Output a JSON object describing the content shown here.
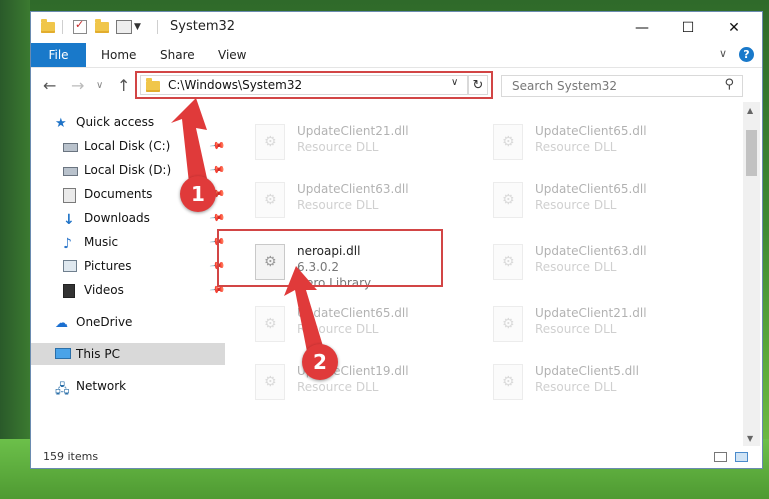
{
  "window": {
    "title": "System32",
    "controls": {
      "minimize": "—",
      "maximize": "☐",
      "close": "✕"
    }
  },
  "ribbon": {
    "tabs": [
      "File",
      "Home",
      "Share",
      "View"
    ],
    "help": "?"
  },
  "address": {
    "path": "C:\\Windows\\System32",
    "refresh_icon": "↻"
  },
  "search": {
    "placeholder": "Search System32"
  },
  "sidebar": {
    "items": [
      {
        "label": "Quick access",
        "icon": "star-icon"
      },
      {
        "label": "Local Disk (C:)",
        "icon": "drive-icon",
        "pinned": true
      },
      {
        "label": "Local Disk (D:)",
        "icon": "drive-icon",
        "pinned": true
      },
      {
        "label": "Documents",
        "icon": "documents-icon",
        "pinned": true
      },
      {
        "label": "Downloads",
        "icon": "download-icon",
        "pinned": true
      },
      {
        "label": "Music",
        "icon": "music-icon",
        "pinned": true
      },
      {
        "label": "Pictures",
        "icon": "pictures-icon",
        "pinned": true
      },
      {
        "label": "Videos",
        "icon": "videos-icon",
        "pinned": true
      },
      {
        "label": "OneDrive",
        "icon": "cloud-icon"
      },
      {
        "label": "This PC",
        "icon": "computer-icon",
        "selected": true
      },
      {
        "label": "Network",
        "icon": "network-icon"
      }
    ]
  },
  "files": {
    "left": [
      {
        "name": "UpdateClient21.dll",
        "type": "Resource DLL"
      },
      {
        "name": "UpdateClient63.dll",
        "type": "Resource DLL"
      },
      {
        "name": "neroapi.dll",
        "version": "6.3.0.2",
        "type": "Nero Library"
      },
      {
        "name": "UpdateClient65.dll",
        "type": "Resource DLL"
      },
      {
        "name": "UpdateClient19.dll",
        "type": "Resource DLL"
      }
    ],
    "right": [
      {
        "name": "UpdateClient65.dll",
        "type": "Resource DLL"
      },
      {
        "name": "UpdateClient65.dll",
        "type": "Resource DLL"
      },
      {
        "name": "UpdateClient63.dll",
        "type": "Resource DLL"
      },
      {
        "name": "UpdateClient21.dll",
        "type": "Resource DLL"
      },
      {
        "name": "UpdateClient5.dll",
        "type": "Resource DLL"
      }
    ]
  },
  "status": {
    "items_count": "159 items"
  },
  "callouts": [
    "1",
    "2"
  ],
  "colors": {
    "accent": "#1979ca",
    "highlight": "#d24545"
  }
}
